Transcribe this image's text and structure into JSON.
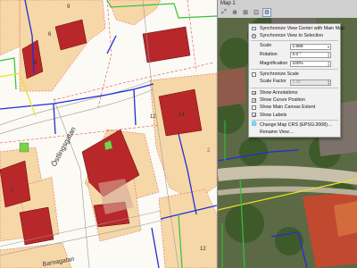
{
  "panel": {
    "title": "Map 1",
    "toolbar": [
      {
        "icon": "zoom-full-icon",
        "glyph": "⤢"
      },
      {
        "icon": "zoom-layer-icon",
        "glyph": "⊕"
      },
      {
        "icon": "zoom-selection-icon",
        "glyph": "⊞"
      },
      {
        "icon": "set-extent-icon",
        "glyph": "⊡"
      },
      {
        "icon": "map-settings-icon",
        "glyph": "⚙"
      }
    ]
  },
  "menu": {
    "sync_center": "Synchronize View Center with Main Map",
    "sync_selection": "Synchronize View to Selection",
    "scale_label": "Scale",
    "scale_value": "1:888",
    "rotation_label": "Rotation",
    "rotation_value": "0.0 °",
    "magnification_label": "Magnification",
    "magnification_value": "100%",
    "sync_scale": "Synchronize Scale",
    "scale_factor_label": "Scale Factor",
    "scale_factor_value": "1.00",
    "show_annotations": "Show Annotations",
    "show_cursor": "Show Cursor Position",
    "show_extent": "Show Main Canvas Extent",
    "show_labels": "Show Labels",
    "change_crs": "Change Map CRS (EPSG:3008)…",
    "rename_view": "Rename View…"
  },
  "map_labels": {
    "street1": "Östlingsgatan",
    "street2": "Barnagatan",
    "n1": "6",
    "n2": "8",
    "n3": "12",
    "n4": "14",
    "n5": "2",
    "n6": "12",
    "n7": "2",
    "n8": "9"
  },
  "colors": {
    "building": "#b8272a",
    "parcel_bg": "#f6d7a7",
    "water_pipe": "#1f2fd8",
    "gas_pipe": "#33c13a",
    "sewer_line": "#e9e51b"
  }
}
